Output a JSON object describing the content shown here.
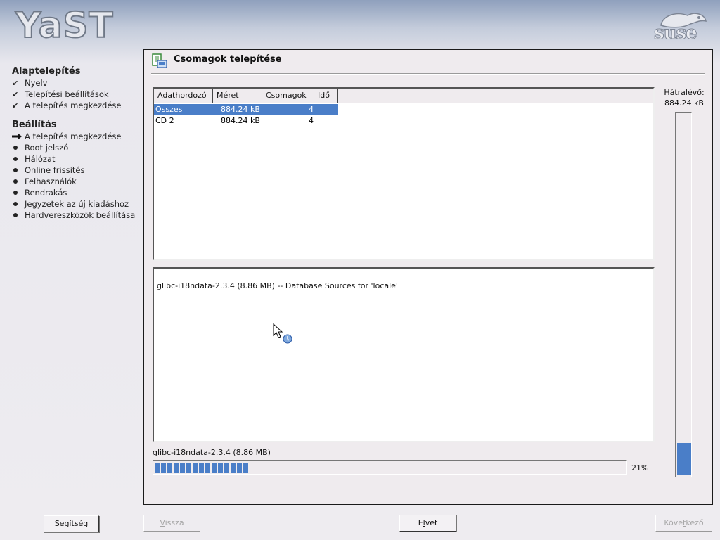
{
  "header": {
    "yast_logo": "YaST",
    "suse_logo": "suse"
  },
  "sidebar": {
    "sections": [
      {
        "title": "Alaptelepítés",
        "steps": [
          {
            "label": "Nyelv",
            "status": "done"
          },
          {
            "label": "Telepítési beállítások",
            "status": "done"
          },
          {
            "label": "A telepítés megkezdése",
            "status": "done"
          }
        ]
      },
      {
        "title": "Beállítás",
        "steps": [
          {
            "label": "A telepítés megkezdése",
            "status": "current"
          },
          {
            "label": "Root jelszó",
            "status": "pending"
          },
          {
            "label": "Hálózat",
            "status": "pending"
          },
          {
            "label": "Online frissítés",
            "status": "pending"
          },
          {
            "label": "Felhasználók",
            "status": "pending"
          },
          {
            "label": "Rendrakás",
            "status": "pending"
          },
          {
            "label": "Jegyzetek az új kiadáshoz",
            "status": "pending"
          },
          {
            "label": "Hardvereszközök beállítása",
            "status": "pending"
          }
        ]
      }
    ]
  },
  "panel": {
    "title": "Csomagok telepítése",
    "table": {
      "headers": [
        "Adathordozó",
        "Méret",
        "Csomagok",
        "Idő"
      ],
      "rows": [
        {
          "media": "Összes",
          "size": "884.24 kB",
          "packages": "4",
          "time": "",
          "selected": true
        },
        {
          "media": "CD 2",
          "size": "884.24 kB",
          "packages": "4",
          "time": "",
          "selected": false
        }
      ]
    },
    "log_line": "glibc-i18ndata-2.3.4 (8.86 MB) -- Database Sources for 'locale'",
    "current_package": "glibc-i18ndata-2.3.4 (8.86 MB)",
    "progress_percent": 21,
    "progress_label": "21%",
    "remaining_label": "Hátralévő:",
    "remaining_value": "884.24 kB",
    "remaining_fill_fraction": 0.09
  },
  "buttons": {
    "help": {
      "label": "Segítség",
      "mnemonic_prefix": "Segí",
      "mnemonic": "t",
      "suffix": "ség"
    },
    "back": {
      "label": "Vissza",
      "prefix": "",
      "mnemonic": "V",
      "suffix": "issza"
    },
    "abort": {
      "label": "Elvet",
      "prefix": "E",
      "mnemonic": "l",
      "suffix": "vet"
    },
    "next": {
      "label": "Következő",
      "prefix": "Köve",
      "mnemonic": "t",
      "suffix": "kező"
    }
  },
  "colors": {
    "accent": "#4a7ec8",
    "panel_bg": "#efebee"
  }
}
